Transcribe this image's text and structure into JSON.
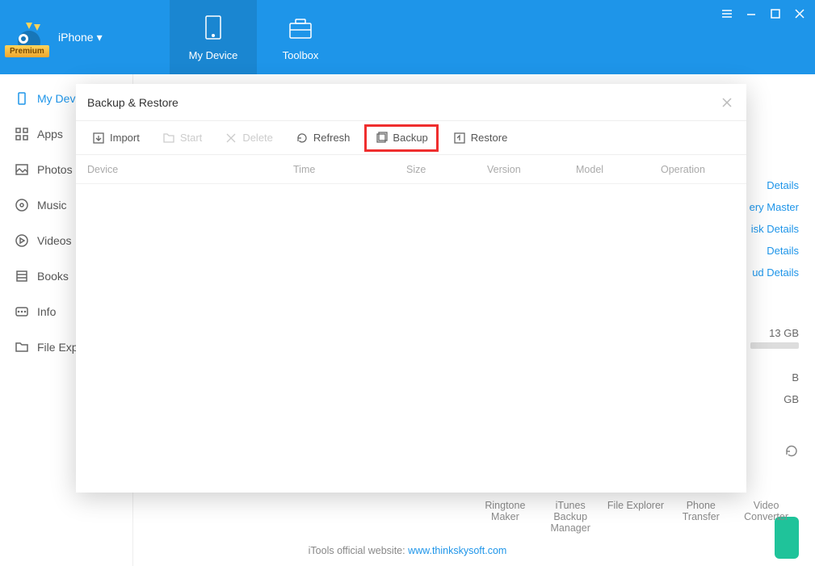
{
  "header": {
    "device_label": "iPhone",
    "premium_badge": "Premium",
    "tabs": [
      {
        "label": "My Device"
      },
      {
        "label": "Toolbox"
      }
    ]
  },
  "sidebar": {
    "items": [
      {
        "label": "My Device",
        "icon": "device"
      },
      {
        "label": "Apps",
        "icon": "apps"
      },
      {
        "label": "Photos",
        "icon": "photos"
      },
      {
        "label": "Music",
        "icon": "music"
      },
      {
        "label": "Videos",
        "icon": "videos"
      },
      {
        "label": "Books",
        "icon": "books"
      },
      {
        "label": "Info",
        "icon": "info"
      },
      {
        "label": "File Explorer",
        "icon": "files"
      }
    ]
  },
  "right_panel": {
    "links": [
      "Details",
      "ery Master",
      "isk Details",
      "Details",
      "ud Details"
    ],
    "storage1": "13 GB",
    "storage2": "B",
    "storage3": "GB"
  },
  "bottom_tools": [
    "Ringtone Maker",
    "iTunes Backup Manager",
    "File Explorer",
    "Phone Transfer",
    "Video Converter"
  ],
  "footer": {
    "text": "iTools official website: ",
    "link": "www.thinkskysoft.com"
  },
  "dialog": {
    "title": "Backup & Restore",
    "toolbar": {
      "import": "Import",
      "start": "Start",
      "delete": "Delete",
      "refresh": "Refresh",
      "backup": "Backup",
      "restore": "Restore"
    },
    "columns": {
      "device": "Device",
      "time": "Time",
      "size": "Size",
      "version": "Version",
      "model": "Model",
      "operation": "Operation"
    }
  }
}
